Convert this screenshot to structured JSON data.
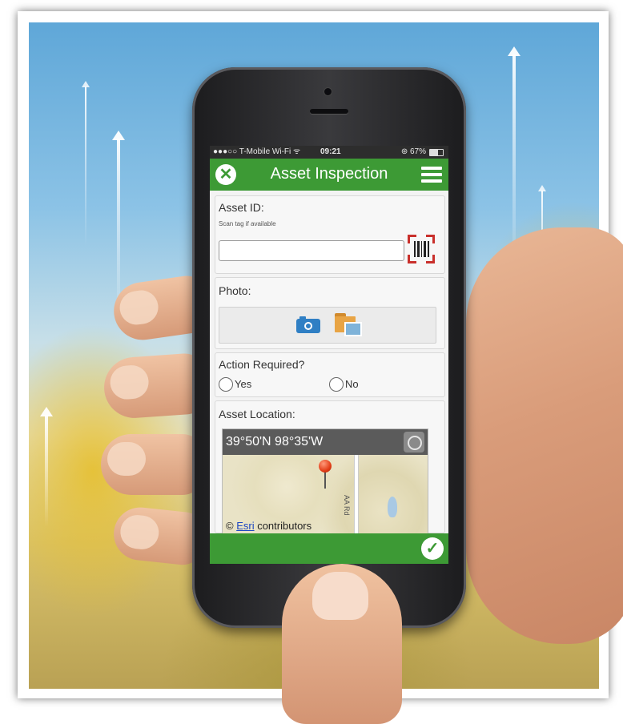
{
  "statusbar": {
    "carrier": "●●●○○ T-Mobile Wi-Fi ᯤ",
    "time": "09:21",
    "battery": "⊛ 67%"
  },
  "header": {
    "title": "Asset Inspection",
    "close_icon": "✕",
    "menu_icon": "menu-icon"
  },
  "asset_id": {
    "label": "Asset ID:",
    "hint": "Scan tag if available",
    "value": "",
    "scan_icon": "barcode-scan-icon"
  },
  "photo": {
    "label": "Photo:",
    "camera_icon": "camera-icon",
    "folder_icon": "image-folder-icon"
  },
  "action_required": {
    "label": "Action Required?",
    "options": [
      "Yes",
      "No"
    ],
    "selected": null
  },
  "asset_location": {
    "label": "Asset Location:",
    "coordinates": "39°50'N 98°35'W",
    "road_label": "AA Rd",
    "attribution_prefix": "© ",
    "attribution_link": "Esri",
    "attribution_suffix": " contributors"
  },
  "footer": {
    "submit_icon": "✓"
  },
  "colors": {
    "accent_green": "#3d9a35",
    "coord_bar": "#5b5b5b",
    "link_blue": "#1d46c2"
  }
}
